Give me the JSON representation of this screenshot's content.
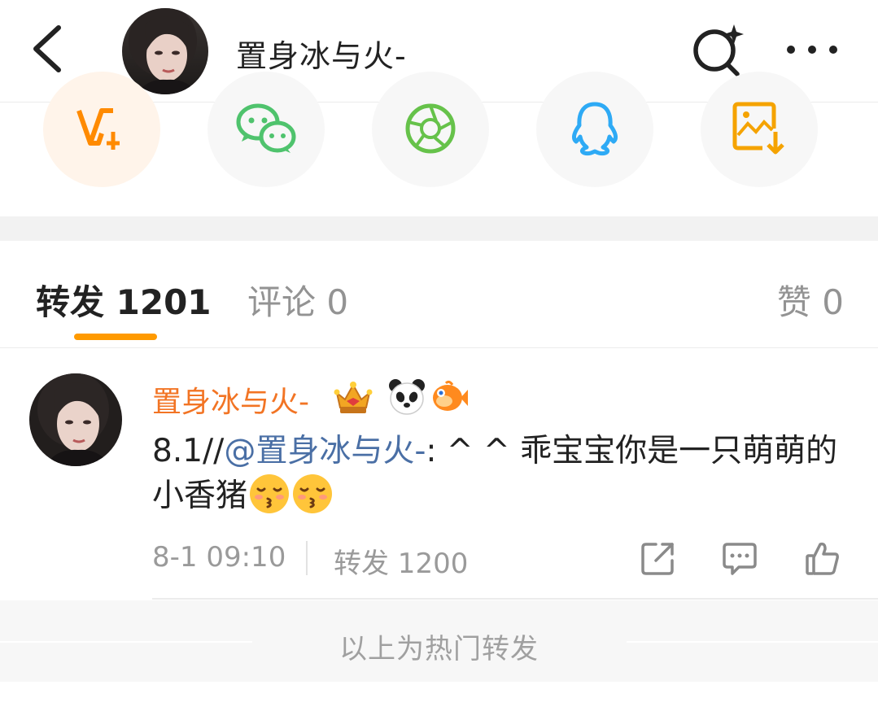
{
  "header": {
    "title": "置身冰与火-",
    "back_icon": "chevron-left-icon",
    "search_icon": "sparkle-search-icon",
    "more_icon": "more-dots-icon"
  },
  "share": [
    {
      "name": "vip-share",
      "icon": "vip-plus-icon",
      "color": "#ff8a00"
    },
    {
      "name": "wechat-share",
      "icon": "wechat-icon",
      "color": "#4fc36d"
    },
    {
      "name": "moments-share",
      "icon": "moments-icon",
      "color": "#66c24a"
    },
    {
      "name": "qq-share",
      "icon": "qq-icon",
      "color": "#2eaaf5"
    },
    {
      "name": "save-image",
      "icon": "image-download-icon",
      "color": "#f5a300"
    }
  ],
  "tabs": {
    "repost": "转发 1201",
    "comment": "评论 0",
    "like": "赞 0",
    "accent_color": "#ff9a00"
  },
  "post": {
    "username": "置身冰与火-",
    "text_prefix": "8.1//",
    "mention": "@置身冰与火-",
    "text_body": ": ^ ^ 乖宝宝你是一只萌萌的小香猪",
    "time": "8-1 09:10",
    "reposts": "转发 1200",
    "badges": [
      "crown-badge-icon",
      "panda-badge-icon",
      "fish-badge-icon"
    ],
    "username_color": "#f27424",
    "mention_color": "#4a6fa5"
  },
  "footer": {
    "hot_label": "以上为热门转发"
  }
}
